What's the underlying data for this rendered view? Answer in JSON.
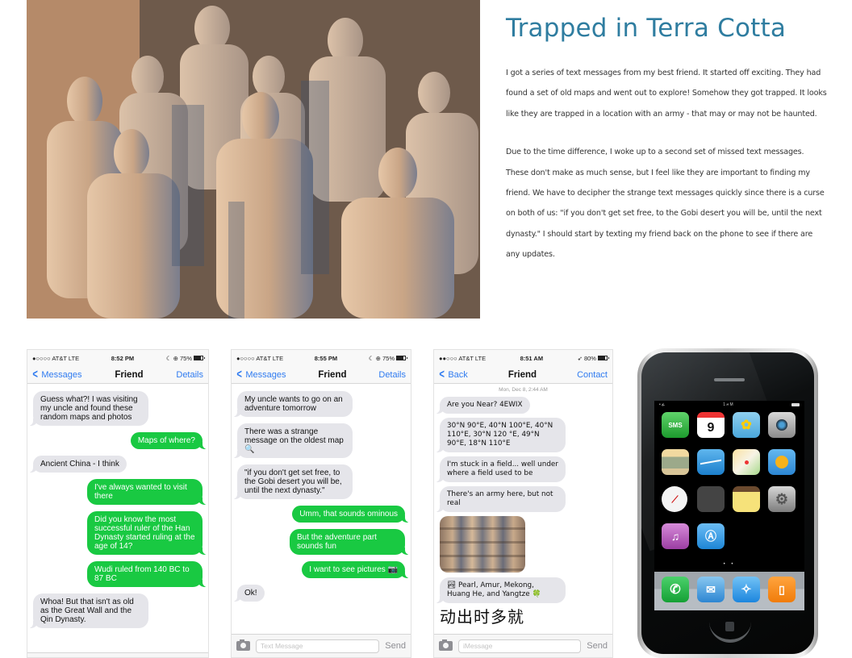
{
  "hero": {
    "alt": "Terracotta warriors statues"
  },
  "article": {
    "title": "Trapped in Terra Cotta",
    "paragraph_1": "I got a series of text messages from my best friend. It started off exciting. They had found a set of old maps and went out to explore! Somehow they got trapped. It looks like they are trapped in a location with an army - that may or may not be haunted.",
    "paragraph_2": "Due to the time difference, I woke up to a second set of missed text messages. These don't make as much sense, but I feel like they are important to finding my friend. We have to decipher the strange text messages quickly since there is a curse on both of us: \"if you don't get set free, to the Gobi desert you will be, until the next dynasty.\"  I should start by texting my friend back on the phone to see if there are any updates."
  },
  "colors": {
    "title": "#2f7da0",
    "ios_blue": "#2f7bf0",
    "sms_green": "#19c942",
    "incoming_gray": "#e5e5ea"
  },
  "screenshots": [
    {
      "status": {
        "carrier": "●○○○○ AT&T  LTE",
        "time": "8:52 PM",
        "right": "☾ ⊕ 75%",
        "battery_level": 0.75
      },
      "nav": {
        "back": "Messages",
        "title": "Friend",
        "action": "Details"
      },
      "messages": [
        {
          "dir": "in",
          "text": "Guess what?! I was visiting my uncle and found these random maps and photos"
        },
        {
          "dir": "out",
          "text": "Maps of where?"
        },
        {
          "dir": "in",
          "text": "Ancient China - I think"
        },
        {
          "dir": "out",
          "text": "I've always wanted to visit there"
        },
        {
          "dir": "out",
          "text": "Did you know the most successful ruler of the Han Dynasty started ruling at the age of 14?"
        },
        {
          "dir": "out",
          "text": "Wudi ruled from 140 BC to 87 BC"
        },
        {
          "dir": "in",
          "text": "Whoa! But that isn't as old as the Great Wall and the Qin Dynasty."
        }
      ]
    },
    {
      "status": {
        "carrier": "●○○○○ AT&T  LTE",
        "time": "8:55 PM",
        "right": "☾ ⊕ 75%",
        "battery_level": 0.75
      },
      "nav": {
        "back": "Messages",
        "title": "Friend",
        "action": "Details"
      },
      "messages": [
        {
          "dir": "in",
          "text": "My uncle wants to go on an adventure tomorrow"
        },
        {
          "dir": "in",
          "text": "There was a strange message on the oldest map 🔍"
        },
        {
          "dir": "in",
          "text": "\"if you don't get set free, to the Gobi desert you will be, until the next dynasty.\""
        },
        {
          "dir": "out",
          "text": "Umm, that sounds ominous"
        },
        {
          "dir": "out",
          "text": "But the adventure part sounds fun"
        },
        {
          "dir": "out",
          "text": "I want to see pictures 📷"
        },
        {
          "dir": "in",
          "text": "Ok!"
        }
      ],
      "input": {
        "placeholder": "Text Message",
        "send": "Send"
      }
    },
    {
      "status": {
        "carrier": "●●○○○ AT&T LTE",
        "time": "8:51 AM",
        "right": "➶ 80%",
        "battery_level": 0.8
      },
      "nav": {
        "back": "Back",
        "title": "Friend",
        "action": "Contact"
      },
      "timestamp": "Mon, Dec 8, 2:44 AM",
      "messages": [
        {
          "dir": "in",
          "text": "Are you Near? 4EWIX"
        },
        {
          "dir": "in",
          "text": "30°N 90°E, 40°N 100°E, 40°N 110°E, 30°N 120 °E, 49°N 90°E, 18°N 110°E"
        },
        {
          "dir": "in",
          "text": "I'm stuck in a field... well under where a field used to be"
        },
        {
          "dir": "in",
          "text": "There's an army here, but not real"
        },
        {
          "dir": "in",
          "text": "🏞 Pearl, Amur, Mekong, Huang He, and Yangtze 🍀"
        }
      ],
      "photo_alt": "Terracotta army photo",
      "chinese_text": "动出时多就",
      "input": {
        "placeholder": "iMessage",
        "send": "Send"
      }
    }
  ],
  "iphone": {
    "status_left": "•  ፊ",
    "status_center": "1 ዞ  M",
    "apps": [
      {
        "name": "sms",
        "glyph": "SMS",
        "label": "Text"
      },
      {
        "name": "calendar",
        "glyph": "9",
        "label": "Calendar"
      },
      {
        "name": "photos",
        "glyph": "✿",
        "label": "Photos"
      },
      {
        "name": "camera",
        "glyph": "",
        "label": "Camera"
      },
      {
        "name": "youtube",
        "glyph": "",
        "label": "YouTube"
      },
      {
        "name": "stocks",
        "glyph": "",
        "label": "Stocks"
      },
      {
        "name": "maps",
        "glyph": "",
        "label": "Maps"
      },
      {
        "name": "weather",
        "glyph": "",
        "label": "Weather"
      },
      {
        "name": "clock",
        "glyph": "",
        "label": "Clock"
      },
      {
        "name": "calculator",
        "glyph": "",
        "label": "Calculator"
      },
      {
        "name": "notes",
        "glyph": "",
        "label": "Notes"
      },
      {
        "name": "settings",
        "glyph": "",
        "label": "Settings"
      },
      {
        "name": "itunes",
        "glyph": "♫",
        "label": "iTunes"
      },
      {
        "name": "app-store",
        "glyph": "Ⓐ",
        "label": "App Store"
      }
    ],
    "dock": [
      {
        "name": "phone",
        "glyph": "✆",
        "label": "Phone"
      },
      {
        "name": "mail",
        "glyph": "✉",
        "label": "Mail"
      },
      {
        "name": "safari",
        "glyph": "✧",
        "label": "Safari"
      },
      {
        "name": "ipod",
        "glyph": "▯",
        "label": "iPod"
      }
    ],
    "page_dots": "• •"
  }
}
